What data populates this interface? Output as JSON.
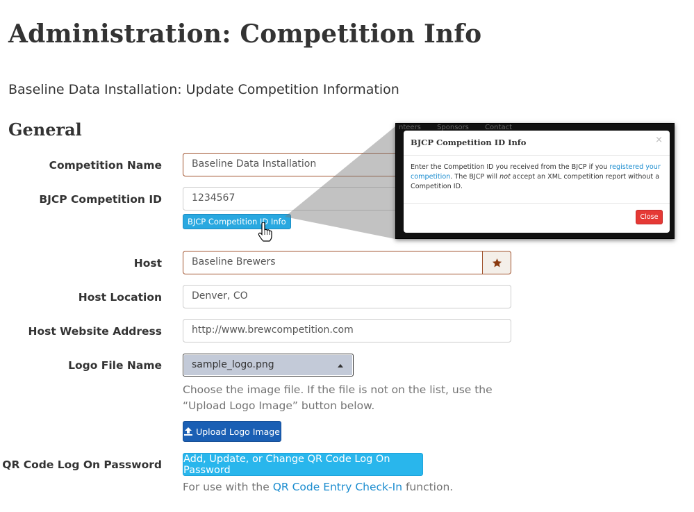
{
  "page": {
    "title": "Administration: Competition Info",
    "subtitle": "Baseline Data Installation: Update Competition Information",
    "section": "General"
  },
  "form": {
    "competition_name": {
      "label": "Competition Name",
      "value": "Baseline Data Installation"
    },
    "bjcp_id": {
      "label": "BJCP Competition ID",
      "value": "1234567",
      "info_button": "BJCP Competition ID Info"
    },
    "host": {
      "label": "Host",
      "value": "Baseline Brewers",
      "addon_icon": "star-icon"
    },
    "host_location": {
      "label": "Host Location",
      "value": "Denver, CO"
    },
    "host_website": {
      "label": "Host Website Address",
      "value": "http://www.brewcompetition.com"
    },
    "logo_file": {
      "label": "Logo File Name",
      "selected": "sample_logo.png",
      "help": "Choose the image file. If the file is not on the list, use the “Upload Logo Image” button below.",
      "upload_button": "Upload Logo Image"
    },
    "qr_password": {
      "label": "QR Code Log On Password",
      "button": "Add, Update, or Change QR Code Log On Password",
      "help_prefix": "For use with the ",
      "help_link": "QR Code Entry Check-In",
      "help_suffix": " function."
    }
  },
  "modal": {
    "nav_fragments": [
      "nteers",
      "Sponsors",
      "Contact"
    ],
    "title": "BJCP Competition ID Info",
    "close_x": "×",
    "body_prefix": "Enter the Competition ID you received from the BJCP if you ",
    "body_link": "registered your competition",
    "body_mid": ". The BJCP will ",
    "body_em": "not",
    "body_suffix": " accept an XML competition report without a Competition ID.",
    "close_button": "Close"
  },
  "colors": {
    "required_border": "#a0522d",
    "info_button": "#29a8e0",
    "upload_button": "#1a5fb4",
    "qr_button": "#29b6ec",
    "close_button": "#e53935",
    "link": "#1a8ccf"
  }
}
